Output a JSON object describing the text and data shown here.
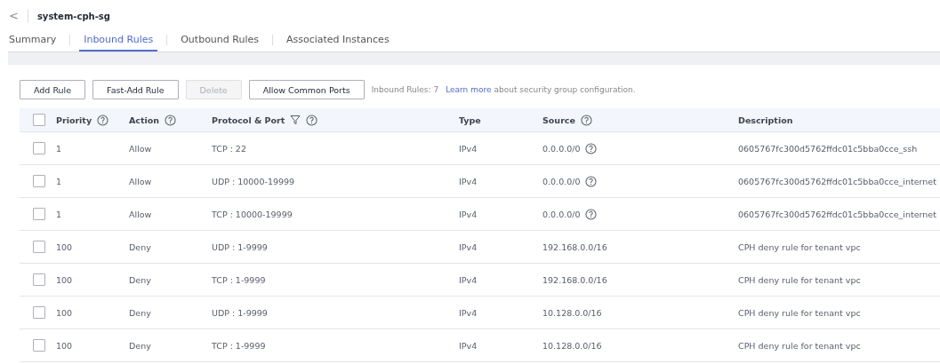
{
  "header": {
    "back": "<",
    "title": "system-cph-sg"
  },
  "tabs": [
    {
      "label": "Summary",
      "selected": false
    },
    {
      "label": "Inbound Rules",
      "selected": true
    },
    {
      "label": "Outbound Rules",
      "selected": false
    },
    {
      "label": "Associated Instances",
      "selected": false
    }
  ],
  "toolbar": {
    "buttons": [
      {
        "label": "Add Rule",
        "disabled": false
      },
      {
        "label": "Fast-Add Rule",
        "disabled": false
      },
      {
        "label": "Delete",
        "disabled": true
      },
      {
        "label": "Allow Common Ports",
        "disabled": false
      }
    ],
    "count": "Inbound Rules: 7",
    "link": "Learn more",
    "note": "about security group configuration."
  },
  "table": {
    "select_all": false,
    "columns": [
      {
        "label": "Priority",
        "help": true,
        "filter": false
      },
      {
        "label": "Action",
        "help": true,
        "filter": false
      },
      {
        "label": "Protocol & Port",
        "help": true,
        "filter": true
      },
      {
        "label": "Type",
        "help": false,
        "filter": false
      },
      {
        "label": "Source",
        "help": true,
        "filter": false
      },
      {
        "label": "Description",
        "help": false,
        "filter": false
      }
    ],
    "rows": [
      {
        "checked": false,
        "priority": "1",
        "action": "Allow",
        "protocol": "TCP : 22",
        "type": "IPv4",
        "source": "0.0.0.0/0",
        "source_help": true,
        "description": "0605767fc300d5762ffdc01c5bba0cce_ssh"
      },
      {
        "checked": false,
        "priority": "1",
        "action": "Allow",
        "protocol": "UDP : 10000-19999",
        "type": "IPv4",
        "source": "0.0.0.0/0",
        "source_help": true,
        "description": "0605767fc300d5762ffdc01c5bba0cce_internet"
      },
      {
        "checked": false,
        "priority": "1",
        "action": "Allow",
        "protocol": "TCP : 10000-19999",
        "type": "IPv4",
        "source": "0.0.0.0/0",
        "source_help": true,
        "description": "0605767fc300d5762ffdc01c5bba0cce_internet"
      },
      {
        "checked": false,
        "priority": "100",
        "action": "Deny",
        "protocol": "UDP : 1-9999",
        "type": "IPv4",
        "source": "192.168.0.0/16",
        "source_help": false,
        "description": "CPH deny rule for tenant vpc"
      },
      {
        "checked": false,
        "priority": "100",
        "action": "Deny",
        "protocol": "TCP : 1-9999",
        "type": "IPv4",
        "source": "192.168.0.0/16",
        "source_help": false,
        "description": "CPH deny rule for tenant vpc"
      },
      {
        "checked": false,
        "priority": "100",
        "action": "Deny",
        "protocol": "UDP : 1-9999",
        "type": "IPv4",
        "source": "10.128.0.0/16",
        "source_help": false,
        "description": "CPH deny rule for tenant vpc"
      },
      {
        "checked": false,
        "priority": "100",
        "action": "Deny",
        "protocol": "TCP : 1-9999",
        "type": "IPv4",
        "source": "10.128.0.0/16",
        "source_help": false,
        "description": "CPH deny rule for tenant vpc"
      }
    ]
  }
}
